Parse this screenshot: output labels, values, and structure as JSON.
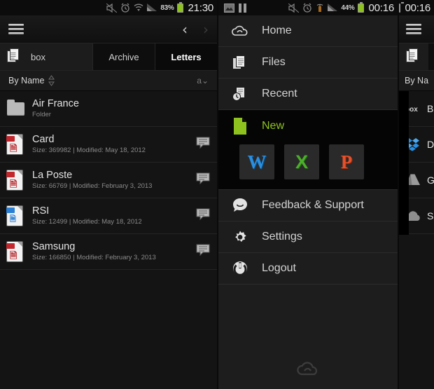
{
  "left_panel": {
    "statusbar": {
      "icons": [
        "mute-icon",
        "alarm-icon",
        "wifi-icon",
        "signal-icon"
      ],
      "battery_percent": "83%",
      "clock": "21:30"
    },
    "actionbar": {
      "menu_icon": "hamburger-icon",
      "prev_label": "‹",
      "next_label": "›"
    },
    "tabbar": {
      "icon": "documents-icon",
      "tabs": [
        {
          "label": "box",
          "selected": false
        },
        {
          "label": "Archive",
          "selected": false
        },
        {
          "label": "Letters",
          "selected": true
        }
      ]
    },
    "sortbar": {
      "label": "By Name",
      "updown_icon": "sort-updown-icon",
      "order_label": "a",
      "order_chevron": "⌄"
    },
    "files": [
      {
        "name": "Air France",
        "sub": "Folder",
        "type": "folder",
        "has_comment": false
      },
      {
        "name": "Card",
        "sub": "Size: 369982 | Modified: May 18, 2012",
        "type": "pdf",
        "has_comment": true
      },
      {
        "name": "La Poste",
        "sub": "Size: 66769 | Modified: February 3, 2013",
        "type": "pdf",
        "has_comment": true
      },
      {
        "name": "RSI",
        "sub": "Size: 12499 | Modified: May 18, 2012",
        "type": "doc",
        "has_comment": true
      },
      {
        "name": "Samsung",
        "sub": "Size: 166850 | Modified: February 3, 2013",
        "type": "pdf",
        "has_comment": true
      }
    ]
  },
  "mid_panel": {
    "statusbar": {
      "left_icons": [
        "image-icon",
        "pause-icon"
      ],
      "icons": [
        "mute-icon",
        "alarm-icon",
        "usb-icon",
        "signal-icon"
      ],
      "battery_percent": "44%",
      "clock": "00:16"
    },
    "drawer": {
      "items": [
        {
          "label": "Home",
          "icon": "cloud-home-icon"
        },
        {
          "label": "Files",
          "icon": "documents-icon"
        },
        {
          "label": "Recent",
          "icon": "recent-clock-icon"
        },
        {
          "label": "New",
          "icon": "new-document-icon",
          "highlight": true
        },
        {
          "label": "Feedback & Support",
          "icon": "smiley-icon"
        },
        {
          "label": "Settings",
          "icon": "gear-icon"
        },
        {
          "label": "Logout",
          "icon": "power-icon"
        }
      ],
      "new_tiles": [
        {
          "label": "W",
          "name": "new-word-document",
          "color": "#2b8fe0"
        },
        {
          "label": "X",
          "name": "new-excel-spreadsheet",
          "color": "#4caf2a"
        },
        {
          "label": "P",
          "name": "new-powerpoint-presentation",
          "color": "#e8502a"
        }
      ],
      "watermark_icon": "cloud-logo-icon"
    }
  },
  "right_panel": {
    "statusbar": {
      "clock": "00:16"
    },
    "actionbar": {
      "menu_icon": "hamburger-icon"
    },
    "tabbar": {
      "icon": "documents-icon",
      "tab_label": ""
    },
    "sortbar": {
      "label": "By Na"
    },
    "services": [
      {
        "label": "B",
        "icon": "box-icon"
      },
      {
        "label": "D",
        "icon": "dropbox-icon"
      },
      {
        "label": "G",
        "icon": "google-drive-icon"
      },
      {
        "label": "S",
        "icon": "skydrive-icon"
      }
    ]
  },
  "theme": {
    "accent_green": "#8ec21f",
    "bg_dark": "#141414",
    "bg_drawer": "#1d1d1d",
    "text_primary": "#e4e4e4",
    "text_secondary": "#8a8a8a"
  }
}
